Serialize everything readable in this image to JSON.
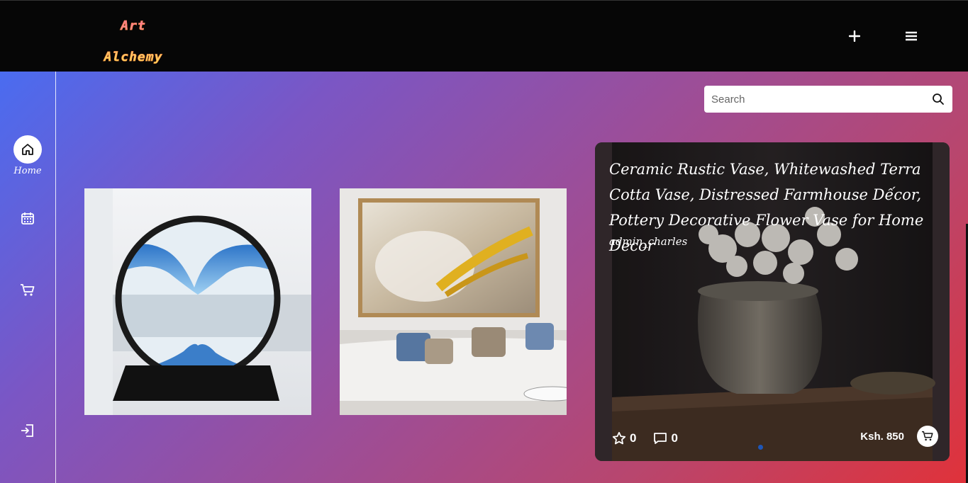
{
  "brand": {
    "line1": "Art",
    "line2": "Alchemy"
  },
  "topbar": {
    "add_icon": "plus-icon",
    "menu_icon": "hamburger-menu-icon"
  },
  "sidebar": {
    "items": [
      {
        "label": "Home",
        "icon": "home-icon",
        "active": true
      },
      {
        "label": "",
        "icon": "calendar-icon"
      },
      {
        "label": "",
        "icon": "cart-icon"
      },
      {
        "label": "",
        "icon": "logout-icon"
      }
    ]
  },
  "search": {
    "placeholder": "Search",
    "icon": "search-icon"
  },
  "products": [
    {
      "name": "sand-art-hourglass-image"
    },
    {
      "name": "abstract-wall-art-living-room-image"
    }
  ],
  "featured": {
    "title": "Ceramic Rustic Vase, Whitewashed Terra Cotta Vase, Distressed Farmhouse Dếcor, Pottery Decorative Flower Vase for Home Decor",
    "author": "admin_charles",
    "stars": "0",
    "comments": "0",
    "price": "Ksh. 850"
  },
  "colors": {
    "topbar": "#060606",
    "gradient_start": "#4a6cf0",
    "gradient_end": "#e0323a",
    "active_dot": "#1e56b8"
  }
}
